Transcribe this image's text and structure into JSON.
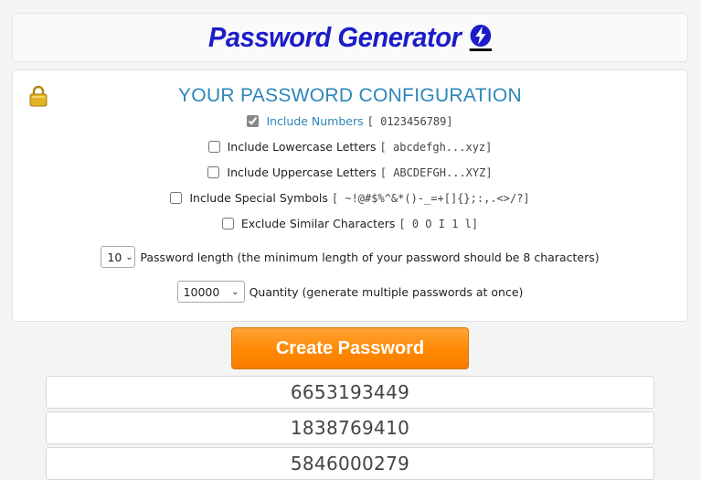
{
  "header": {
    "title": "Password Generator"
  },
  "config": {
    "title": "YOUR PASSWORD CONFIGURATION",
    "options": [
      {
        "label": "Include Numbers",
        "sample": "[ 0123456789]",
        "checked": true
      },
      {
        "label": "Include Lowercase Letters",
        "sample": "[ abcdefgh...xyz]",
        "checked": false
      },
      {
        "label": "Include Uppercase Letters",
        "sample": "[ ABCDEFGH...XYZ]",
        "checked": false
      },
      {
        "label": "Include Special Symbols",
        "sample": "[ ~!@#$%^&*()-_=+[]{};:,.<>/?]",
        "checked": false
      },
      {
        "label": "Exclude Similar Characters",
        "sample": "[ 0 O I 1 l]",
        "checked": false
      }
    ],
    "length": {
      "value": "10",
      "label": "Password length (the minimum length of your password should be 8 characters)"
    },
    "quantity": {
      "value": "10000",
      "label": "Quantity (generate multiple passwords at once)"
    }
  },
  "create_button": {
    "label": "Create Password"
  },
  "results": [
    "6653193449",
    "1838769410",
    "5846000279"
  ],
  "colors": {
    "title": "#1c1cc9",
    "accent": "#2b87b8",
    "button": "#ff8800"
  },
  "icons": {
    "lock": "lock-icon",
    "logo": "lightning-bolt-icon"
  }
}
